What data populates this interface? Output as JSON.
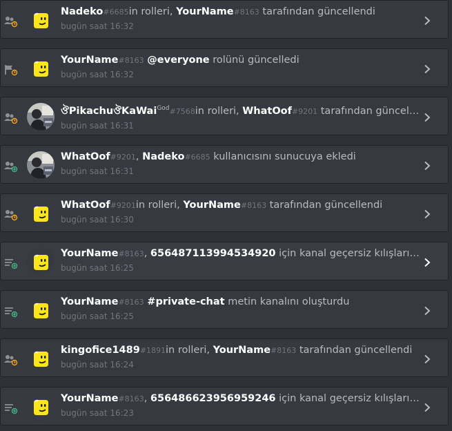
{
  "entries": [
    {
      "icon": "roles-update-icon",
      "avatar": "emoji-avatar",
      "parts": [
        {
          "t": "user",
          "v": "Nadeko"
        },
        {
          "t": "disc",
          "v": "#6685"
        },
        {
          "t": "text",
          "v": "in rolleri, "
        },
        {
          "t": "user",
          "v": "YourName"
        },
        {
          "t": "disc",
          "v": "#8163"
        },
        {
          "t": "text",
          "v": " tarafından güncellendi"
        }
      ],
      "time": "bugün saat 16:32"
    },
    {
      "icon": "flag-update-icon",
      "avatar": "emoji-avatar",
      "parts": [
        {
          "t": "user",
          "v": "YourName"
        },
        {
          "t": "disc",
          "v": "#8163"
        },
        {
          "t": "text",
          "v": " "
        },
        {
          "t": "target",
          "v": "@everyone"
        },
        {
          "t": "text",
          "v": " rolünü güncelledi"
        }
      ],
      "time": "bugün saat 16:32"
    },
    {
      "icon": "roles-update-icon",
      "avatar": "photo-avatar",
      "parts": [
        {
          "t": "user",
          "v": "ঔPikachuঔKaWai"
        },
        {
          "t": "sup",
          "v": "God"
        },
        {
          "t": "disc",
          "v": "#7568"
        },
        {
          "t": "text",
          "v": "in rolleri, "
        },
        {
          "t": "user",
          "v": "WhatOof"
        },
        {
          "t": "disc",
          "v": "#9201"
        },
        {
          "t": "text",
          "v": " tarafından güncellendi"
        }
      ],
      "time": "bugün saat 16:31"
    },
    {
      "icon": "member-add-icon",
      "avatar": "photo-avatar",
      "parts": [
        {
          "t": "user",
          "v": "WhatOof"
        },
        {
          "t": "disc",
          "v": "#9201"
        },
        {
          "t": "text",
          "v": ", "
        },
        {
          "t": "user",
          "v": "Nadeko"
        },
        {
          "t": "disc",
          "v": "#6685"
        },
        {
          "t": "text",
          "v": " kullanıcısını sunucuya ekledi"
        }
      ],
      "time": "bugün saat 16:31"
    },
    {
      "icon": "roles-update-icon",
      "avatar": "emoji-avatar",
      "parts": [
        {
          "t": "user",
          "v": "WhatOof"
        },
        {
          "t": "disc",
          "v": "#9201"
        },
        {
          "t": "text",
          "v": "in rolleri, "
        },
        {
          "t": "user",
          "v": "YourName"
        },
        {
          "t": "disc",
          "v": "#8163"
        },
        {
          "t": "text",
          "v": " tarafından güncellendi"
        }
      ],
      "time": "bugün saat 16:30"
    },
    {
      "icon": "channel-create-icon",
      "avatar": "emoji-avatar",
      "active": true,
      "parts": [
        {
          "t": "user",
          "v": "YourName"
        },
        {
          "t": "disc",
          "v": "#8163"
        },
        {
          "t": "text",
          "v": ", "
        },
        {
          "t": "target",
          "v": "656487113994534920"
        },
        {
          "t": "text",
          "v": " için kanal geçersiz kılışları oluşturdu"
        }
      ],
      "time": "bugün saat 16:25"
    },
    {
      "icon": "channel-create-icon",
      "avatar": "emoji-avatar",
      "parts": [
        {
          "t": "user",
          "v": "YourName"
        },
        {
          "t": "disc",
          "v": "#8163"
        },
        {
          "t": "text",
          "v": " "
        },
        {
          "t": "target",
          "v": "#private-chat"
        },
        {
          "t": "text",
          "v": " metin kanalını oluşturdu"
        }
      ],
      "time": "bugün saat 16:25"
    },
    {
      "icon": "roles-update-icon",
      "avatar": "emoji-avatar",
      "parts": [
        {
          "t": "user",
          "v": "kingofice1489"
        },
        {
          "t": "disc",
          "v": "#1891"
        },
        {
          "t": "text",
          "v": "in rolleri, "
        },
        {
          "t": "user",
          "v": "YourName"
        },
        {
          "t": "disc",
          "v": "#8163"
        },
        {
          "t": "text",
          "v": " tarafından güncellendi"
        }
      ],
      "time": "bugün saat 16:24"
    },
    {
      "icon": "channel-create-icon",
      "avatar": "emoji-avatar",
      "parts": [
        {
          "t": "user",
          "v": "YourName"
        },
        {
          "t": "disc",
          "v": "#8163"
        },
        {
          "t": "text",
          "v": ", "
        },
        {
          "t": "target",
          "v": "656486623956959246"
        },
        {
          "t": "text",
          "v": " için kanal geçersiz kılışları oluşturdu"
        }
      ],
      "time": "bugün saat 16:23"
    }
  ],
  "colors": {
    "background": "#2f3136",
    "entry_bg": "#36393f",
    "update_accent": "#faa61a",
    "create_accent": "#43b581",
    "emoji_yellow": "#fce51b"
  }
}
